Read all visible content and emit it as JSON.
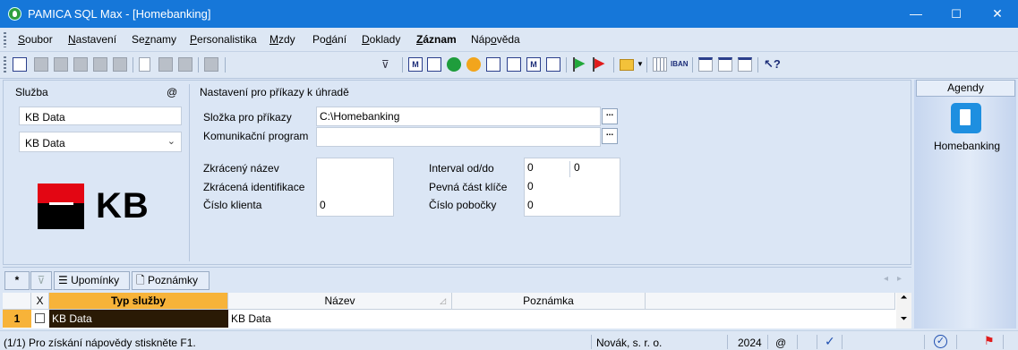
{
  "window": {
    "title": "PAMICA SQL Max - [Homebanking]",
    "minimize": "—",
    "maximize": "☐",
    "close": "✕"
  },
  "menu": {
    "soubor": {
      "u": "S",
      "r": "oubor"
    },
    "nastaveni": {
      "u": "N",
      "r": "astavení"
    },
    "seznamy": {
      "p": "Se",
      "u": "z",
      "r": "namy"
    },
    "personalistika": {
      "u": "P",
      "r": "ersonalistika"
    },
    "mzdy": {
      "u": "M",
      "r": "zdy"
    },
    "podani": {
      "p": "Po",
      "u": "d",
      "r": "ání"
    },
    "doklady": {
      "u": "D",
      "r": "oklady"
    },
    "zaznam": {
      "u": "Z",
      "r": "áznam"
    },
    "napoveda": {
      "p": "Náp",
      "u": "o",
      "r": "věda"
    }
  },
  "toolbar": {
    "combo_value": "",
    "iban": "IBAN",
    "m": "M"
  },
  "sluzba": {
    "label": "Služba",
    "at": "@",
    "input_value": "KB Data",
    "select_value": "KB Data",
    "logo_text": "KB"
  },
  "settings": {
    "header": "Nastavení pro příkazy k úhradě",
    "slozka_label": "Složka pro příkazy",
    "slozka_value": "C:\\Homebanking",
    "komunikacni_label": "Komunikační program",
    "komunikacni_value": "",
    "ellipsis": "...",
    "zkraceny_label": "Zkrácený název",
    "zkraceny_value": "",
    "zkracena_id_label": "Zkrácená identifikace",
    "zkracena_id_value": "",
    "cislo_klienta_label": "Číslo klienta",
    "cislo_klienta_value": "0",
    "interval_label": "Interval od/do",
    "interval_od": "0",
    "interval_do": "0",
    "pevna_label": "Pevná část klíče",
    "pevna_value": "0",
    "pobocka_label": "Číslo pobočky",
    "pobocka_value": "0"
  },
  "agendy": {
    "header": "Agendy",
    "item": "Homebanking"
  },
  "tabs": {
    "star": "*",
    "upominky": "Upomínky",
    "poznamky": "Poznámky",
    "nav_left": "◂",
    "nav_right": "▸"
  },
  "grid": {
    "headers": {
      "x": "X",
      "typ": "Typ služby",
      "nazev": "Název",
      "poznamka": "Poznámka"
    },
    "rows": [
      {
        "num": "1",
        "typ": "KB Data",
        "nazev": "KB Data",
        "poznamka": ""
      }
    ]
  },
  "status": {
    "help": "(1/1) Pro získání nápovědy stiskněte F1.",
    "company": "Novák, s. r. o.",
    "year": "2024",
    "at": "@"
  },
  "colors": {
    "titlebar": "#1677d9",
    "accent": "#f7b339",
    "selected_row": "#2a1a05"
  }
}
